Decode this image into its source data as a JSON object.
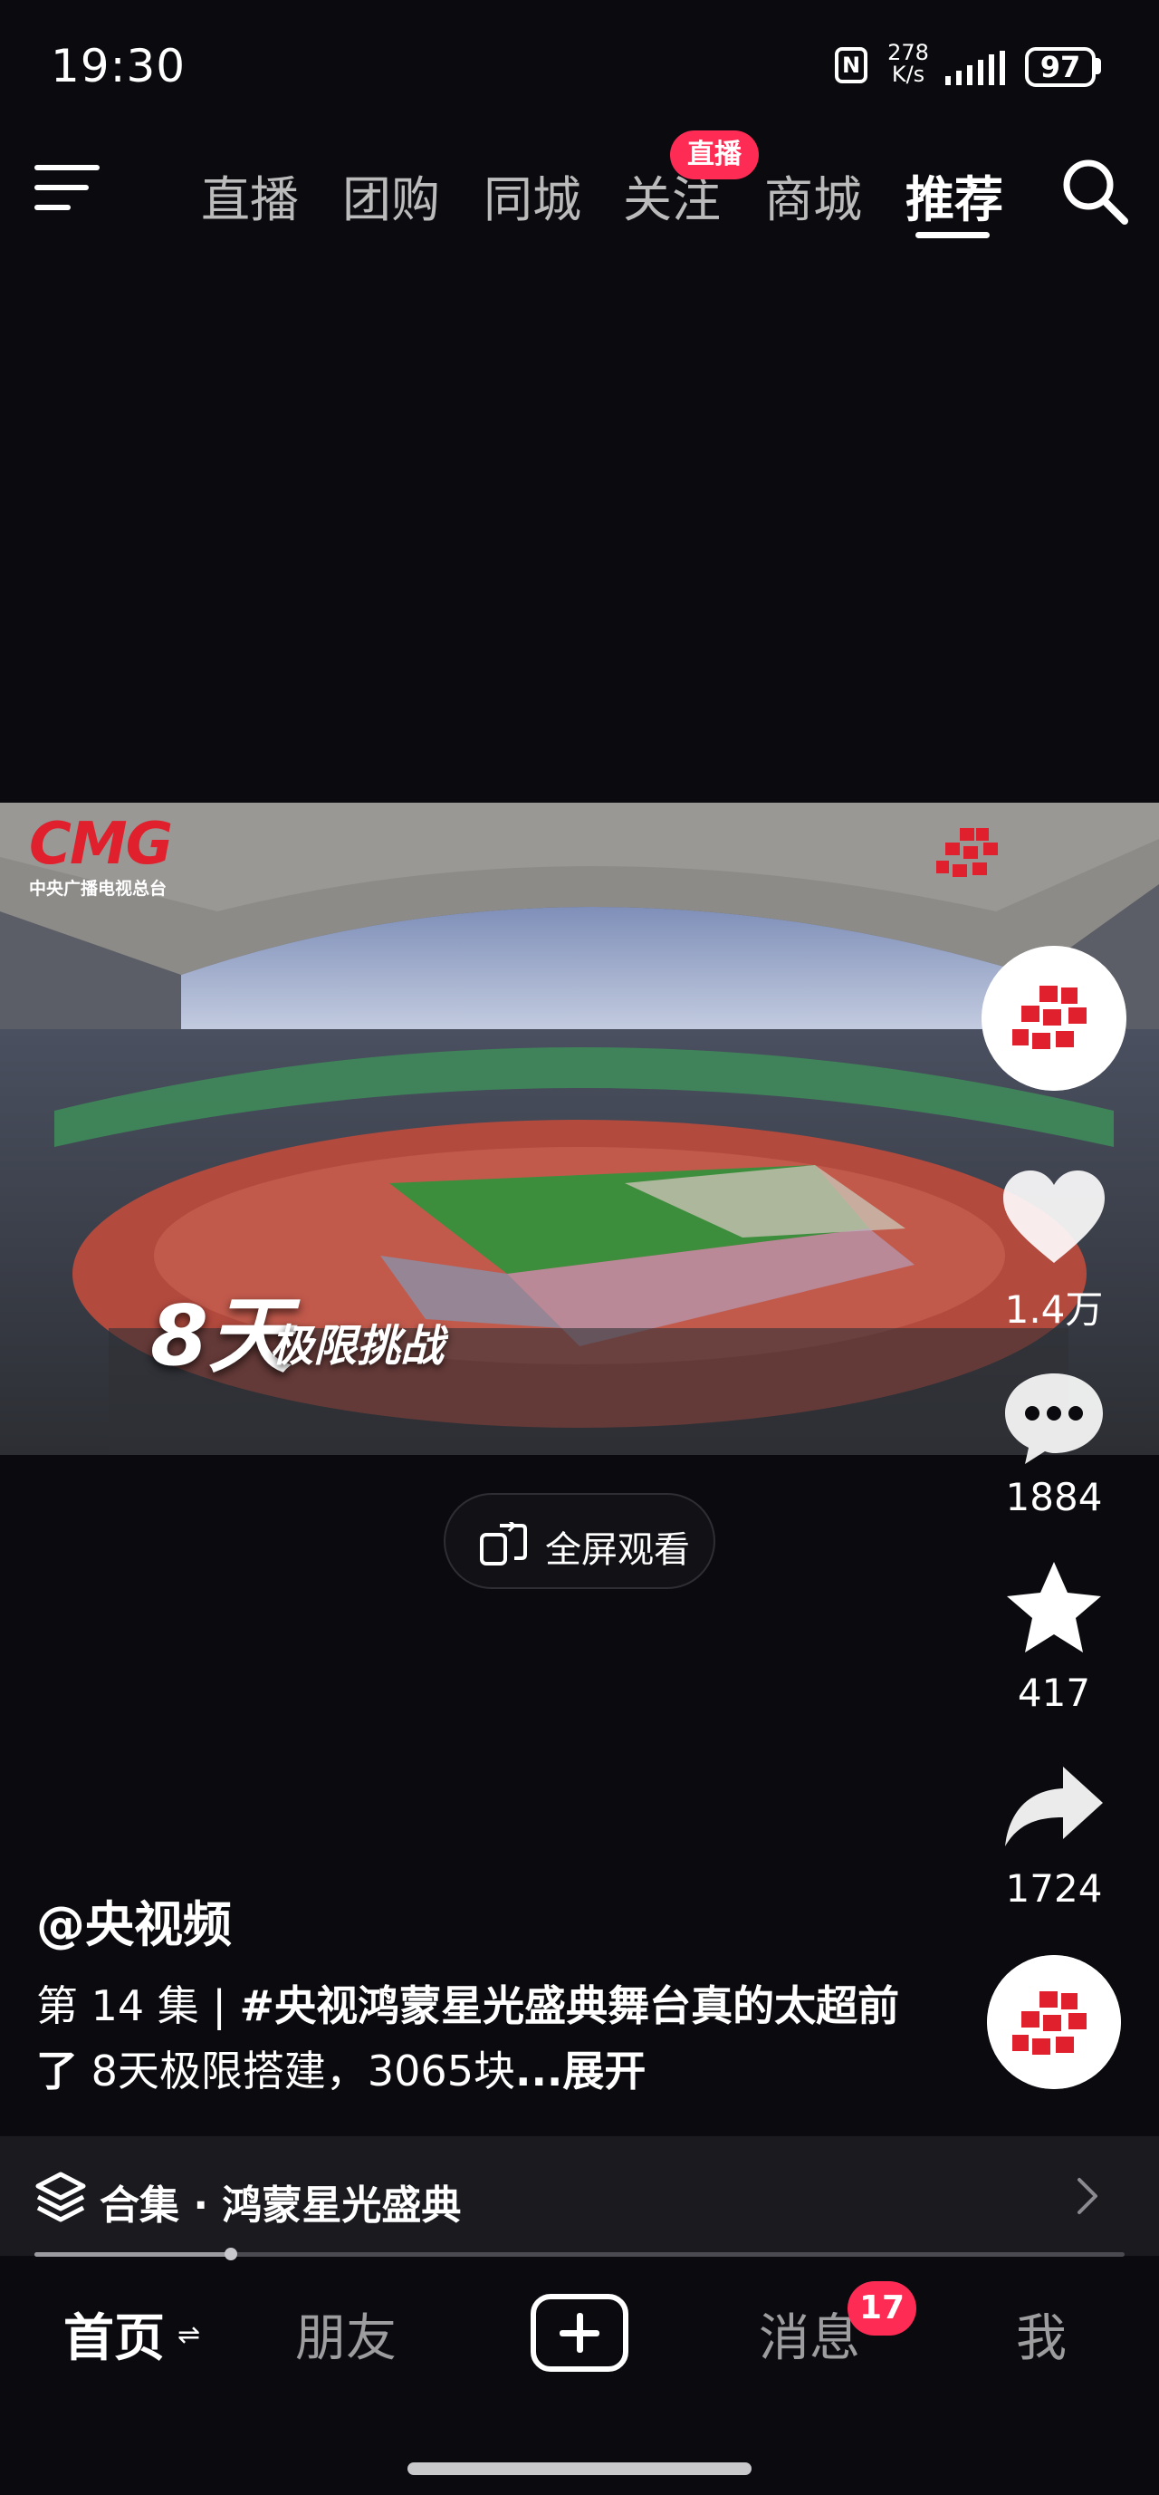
{
  "status_bar": {
    "time": "19:30",
    "net_speed_value": "278",
    "net_speed_unit": "K/s",
    "battery": "97"
  },
  "top_nav": {
    "tabs": [
      {
        "label": "直播"
      },
      {
        "label": "团购"
      },
      {
        "label": "同城"
      },
      {
        "label": "关注"
      },
      {
        "label": "商城"
      },
      {
        "label": "推荐"
      }
    ],
    "active_tab": "推荐",
    "live_badge": "直播"
  },
  "video": {
    "watermark_brand": "CMG",
    "watermark_sub": "中央广播电视总台",
    "overlay_big": "8天",
    "overlay_small": "极限挑战",
    "fullscreen_label": "全屏观看"
  },
  "actions": {
    "likes": "1.4万",
    "comments": "1884",
    "favorites": "417",
    "shares": "1724"
  },
  "post": {
    "author": "@央视频",
    "caption_prefix": "第 14 集 | ",
    "caption_tag": "#央视鸿蒙星光盛典舞台真的太超前了",
    "caption_body": " 8天极限搭建，3065块",
    "caption_more": "...展开"
  },
  "collection": {
    "label": "合集 · 鸿蒙星光盛典"
  },
  "playback": {
    "progress": 0.18
  },
  "bottom_nav": {
    "home": "首页",
    "home_swap": "⇌",
    "friends": "朋友",
    "messages": "消息",
    "messages_badge": "17",
    "me": "我"
  },
  "colors": {
    "accent": "#fe2c55",
    "brand_red": "#e0202c",
    "background": "#0b0b0f"
  }
}
